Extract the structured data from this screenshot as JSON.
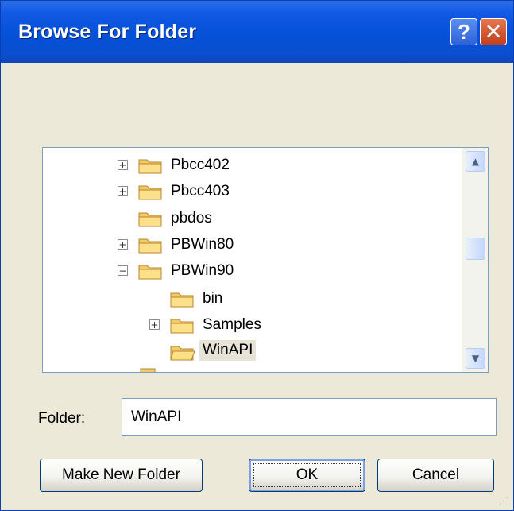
{
  "window": {
    "title": "Browse For Folder"
  },
  "titlebar_buttons": {
    "help": "?",
    "close": "✕"
  },
  "tree": {
    "items": [
      {
        "label": "Pbcc402",
        "expander": "+",
        "selected": false
      },
      {
        "label": "Pbcc403",
        "expander": "+",
        "selected": false
      },
      {
        "label": "pbdos",
        "expander": "",
        "selected": false
      },
      {
        "label": "PBWin80",
        "expander": "+",
        "selected": false
      },
      {
        "label": "PBWin90",
        "expander": "−",
        "selected": false
      },
      {
        "label": "bin",
        "expander": "",
        "selected": false
      },
      {
        "label": "Samples",
        "expander": "+",
        "selected": false
      },
      {
        "label": "WinAPI",
        "expander": "",
        "selected": true
      }
    ]
  },
  "scrollbar": {
    "up_arrow": "▲",
    "down_arrow": "▼"
  },
  "folder": {
    "label": "Folder:",
    "value": "WinAPI"
  },
  "buttons": {
    "make_new_folder": "Make New Folder",
    "ok": "OK",
    "cancel": "Cancel"
  },
  "icons": {
    "folder": "folder-icon",
    "help": "help-icon",
    "close": "close-icon",
    "resize_grip": "resize-grip-icon"
  },
  "colors": {
    "titlebar": "#0551d8",
    "window": "#ece9d8",
    "tree_border": "#7f9db9",
    "selection": "#e7e3d7"
  }
}
